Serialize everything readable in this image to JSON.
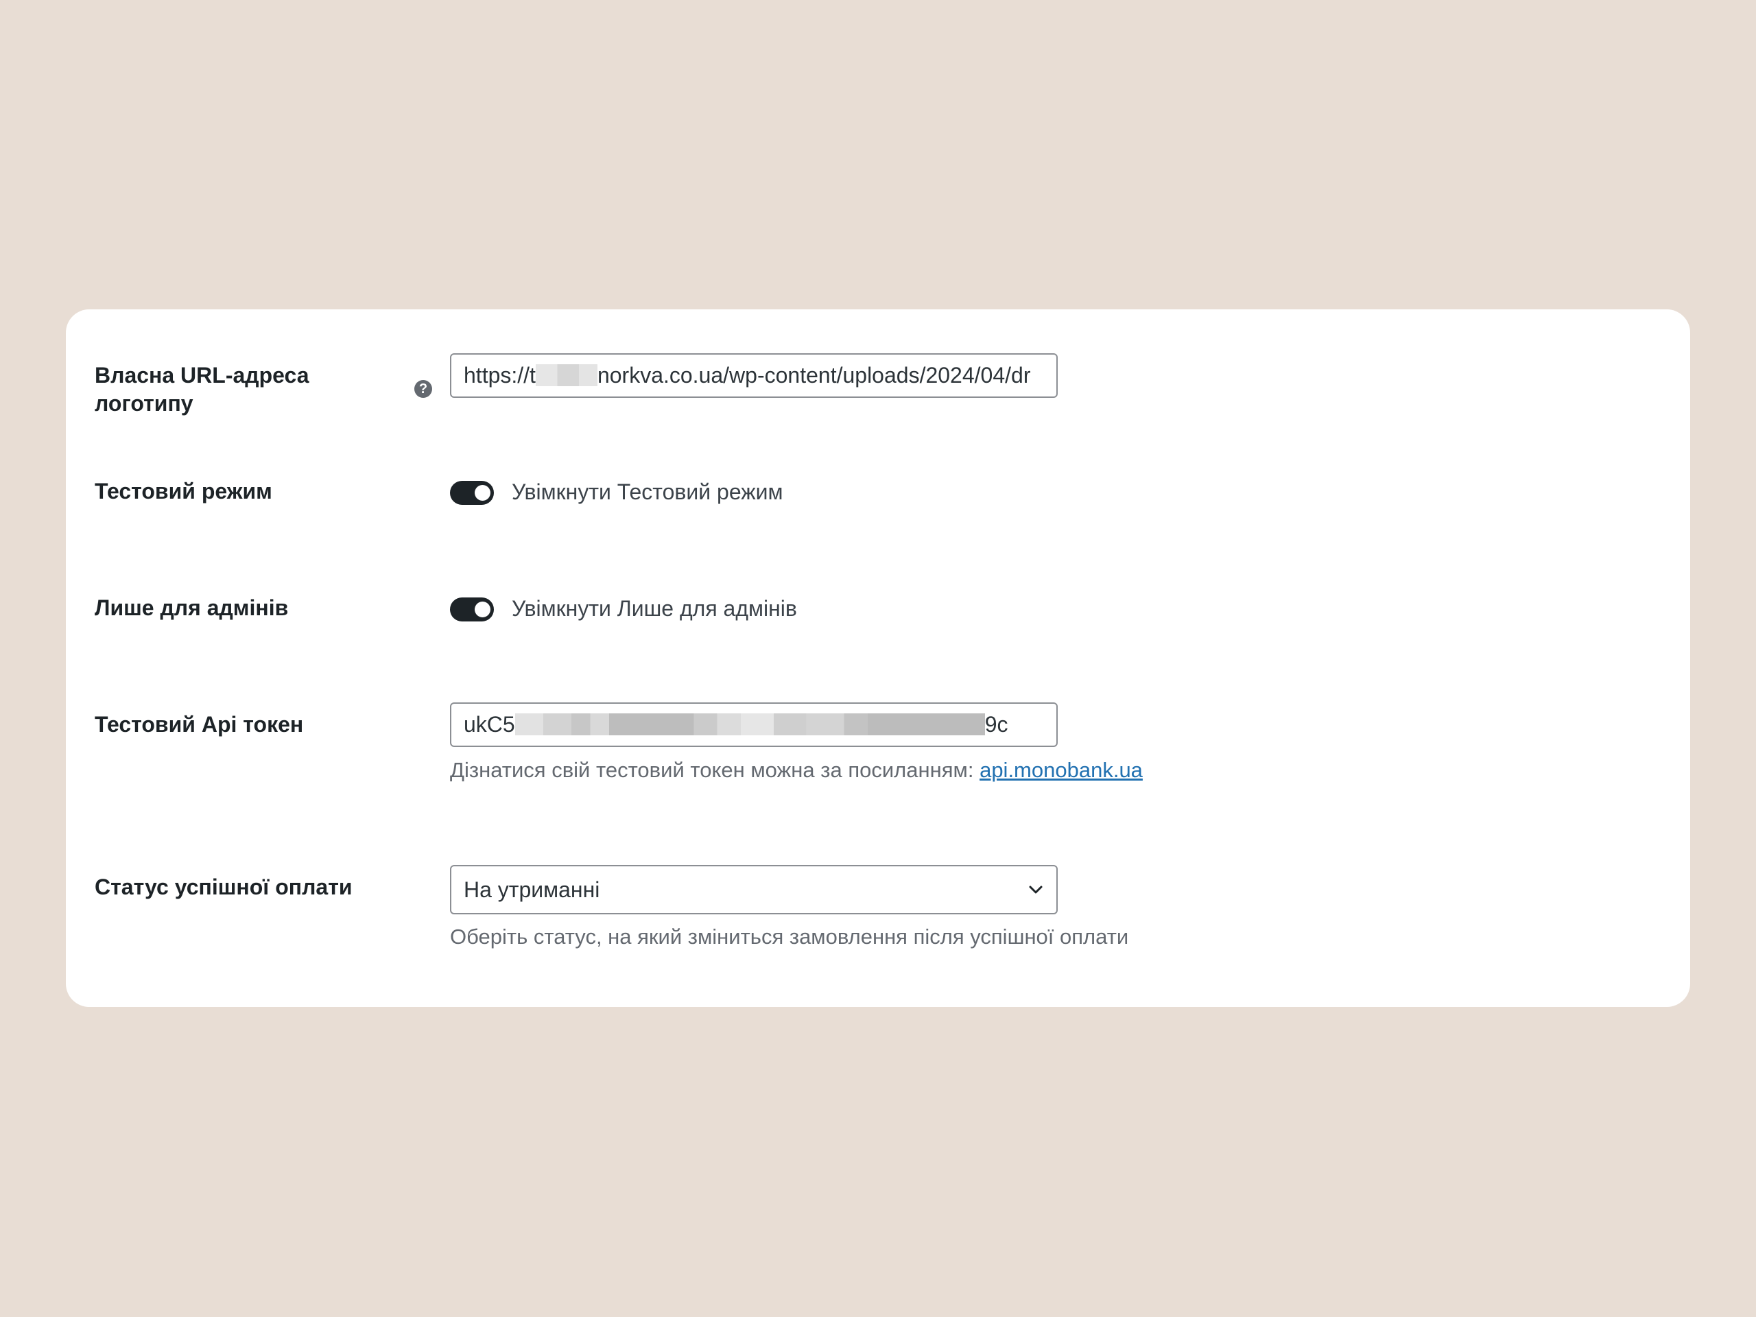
{
  "settings": {
    "logo_url": {
      "label": "Власна URL-адреса логотипу",
      "value_prefix": "https://t",
      "value_suffix": "norkva.co.ua/wp-content/uploads/2024/04/dr",
      "help_icon": "question-mark-icon"
    },
    "test_mode": {
      "label": "Тестовий режим",
      "toggle_label": "Увімкнути Тестовий режим",
      "enabled": true
    },
    "admins_only": {
      "label": "Лише для адмінів",
      "toggle_label": "Увімкнути Лише для адмінів",
      "enabled": true
    },
    "test_api_token": {
      "label": "Тестовий Api токен",
      "value_prefix": "ukC5",
      "value_suffix": "9c",
      "help_text": "Дізнатися свій тестовий токен можна за посиланням:",
      "help_link": "api.monobank.ua"
    },
    "payment_status": {
      "label": "Статус успішної оплати",
      "selected": "На утриманні",
      "help_text": "Оберіть статус, на який зміниться замовлення після успішної оплати"
    }
  },
  "colors": {
    "page_background": "#e8ddd4",
    "card_background": "#ffffff",
    "toggle_on": "#1d2327",
    "link": "#2271b1"
  }
}
